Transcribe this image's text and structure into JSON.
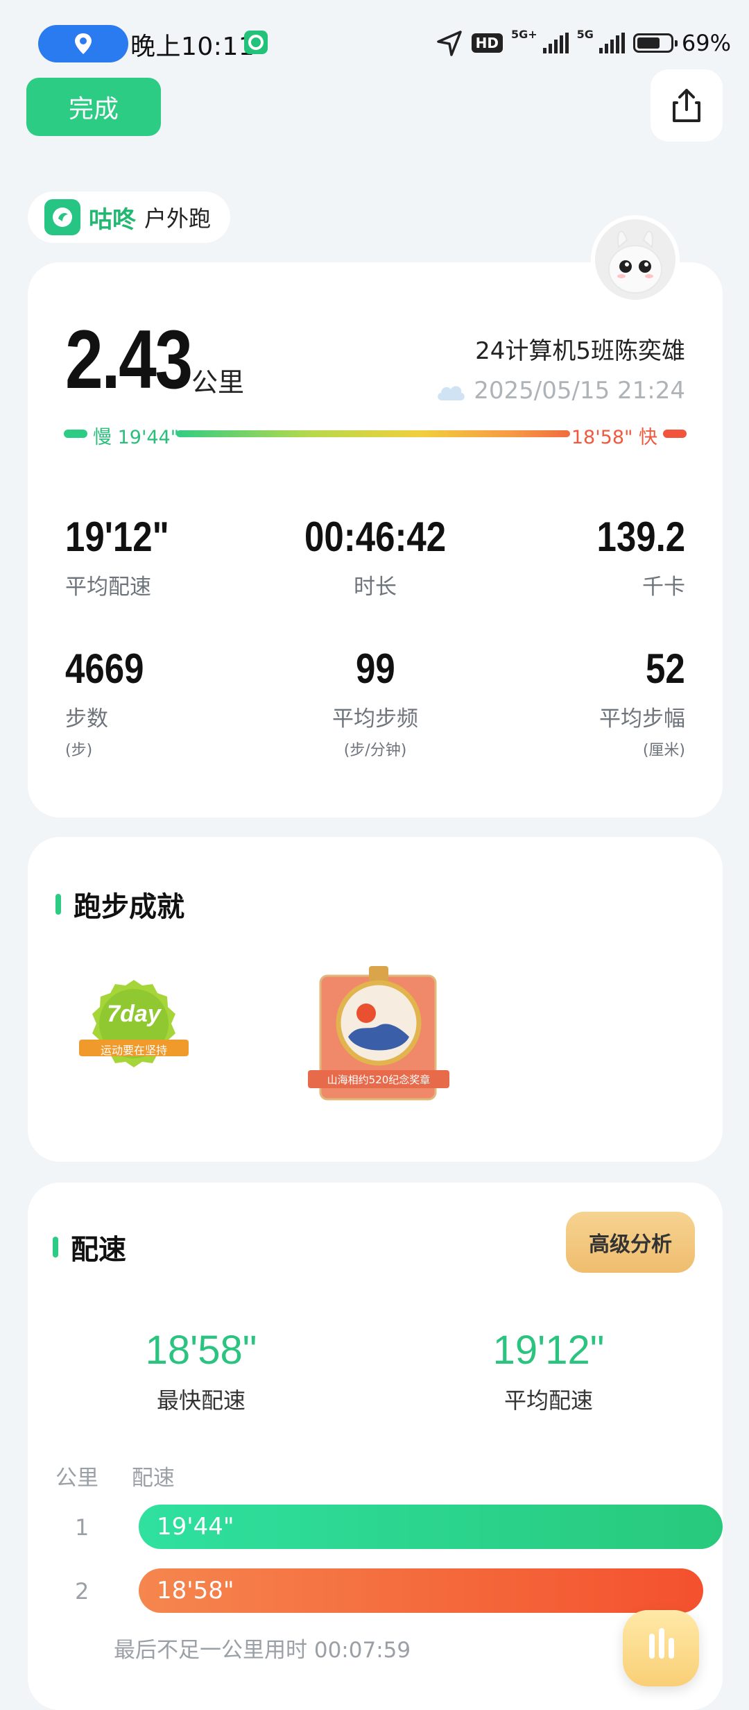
{
  "status_bar": {
    "time": "晚上10:11",
    "hd_label": "HD",
    "sim1_label": "5G+",
    "sim2_label": "5G",
    "battery_text": "69%",
    "battery_level_percent": 69
  },
  "header": {
    "done_label": "完成",
    "share_icon": "share-icon"
  },
  "app_tag": {
    "name": "咕咚",
    "activity": "户外跑"
  },
  "summary": {
    "distance": "2.43",
    "distance_unit": "公里",
    "runner_name": "24计算机5班陈奕雄",
    "datetime": "2025/05/15 21:24",
    "weather_icon": "cloud-icon",
    "pace_slow": "慢 19'44\"",
    "pace_fast": "18'58\" 快",
    "stats": [
      {
        "value": "19'12\"",
        "label": "平均配速",
        "unit": ""
      },
      {
        "value": "00:46:42",
        "label": "时长",
        "unit": ""
      },
      {
        "value": "139.2",
        "label": "千卡",
        "unit": ""
      },
      {
        "value": "4669",
        "label": "步数",
        "unit": "(步)"
      },
      {
        "value": "99",
        "label": "平均步频",
        "unit": "(步/分钟)"
      },
      {
        "value": "52",
        "label": "平均步幅",
        "unit": "(厘米)"
      }
    ]
  },
  "achievements": {
    "title": "跑步成就",
    "badges": [
      {
        "title": "7day",
        "subtitle": "运动要在坚持"
      },
      {
        "title": "山海相约520纪念奖章"
      }
    ]
  },
  "pace": {
    "title": "配速",
    "advanced_label": "高级分析",
    "fastest": "18'58\"",
    "fastest_label": "最快配速",
    "average": "19'12\"",
    "average_label": "平均配速",
    "col_km": "公里",
    "col_pace": "配速",
    "rows": [
      {
        "km": "1",
        "pace": "19'44\""
      },
      {
        "km": "2",
        "pace": "18'58\""
      }
    ],
    "last_segment": "最后不足一公里用时 00:07:59"
  },
  "colors": {
    "brand_green": "#2ccc85",
    "fast_red": "#f2533b",
    "gold": "#f0c070"
  }
}
